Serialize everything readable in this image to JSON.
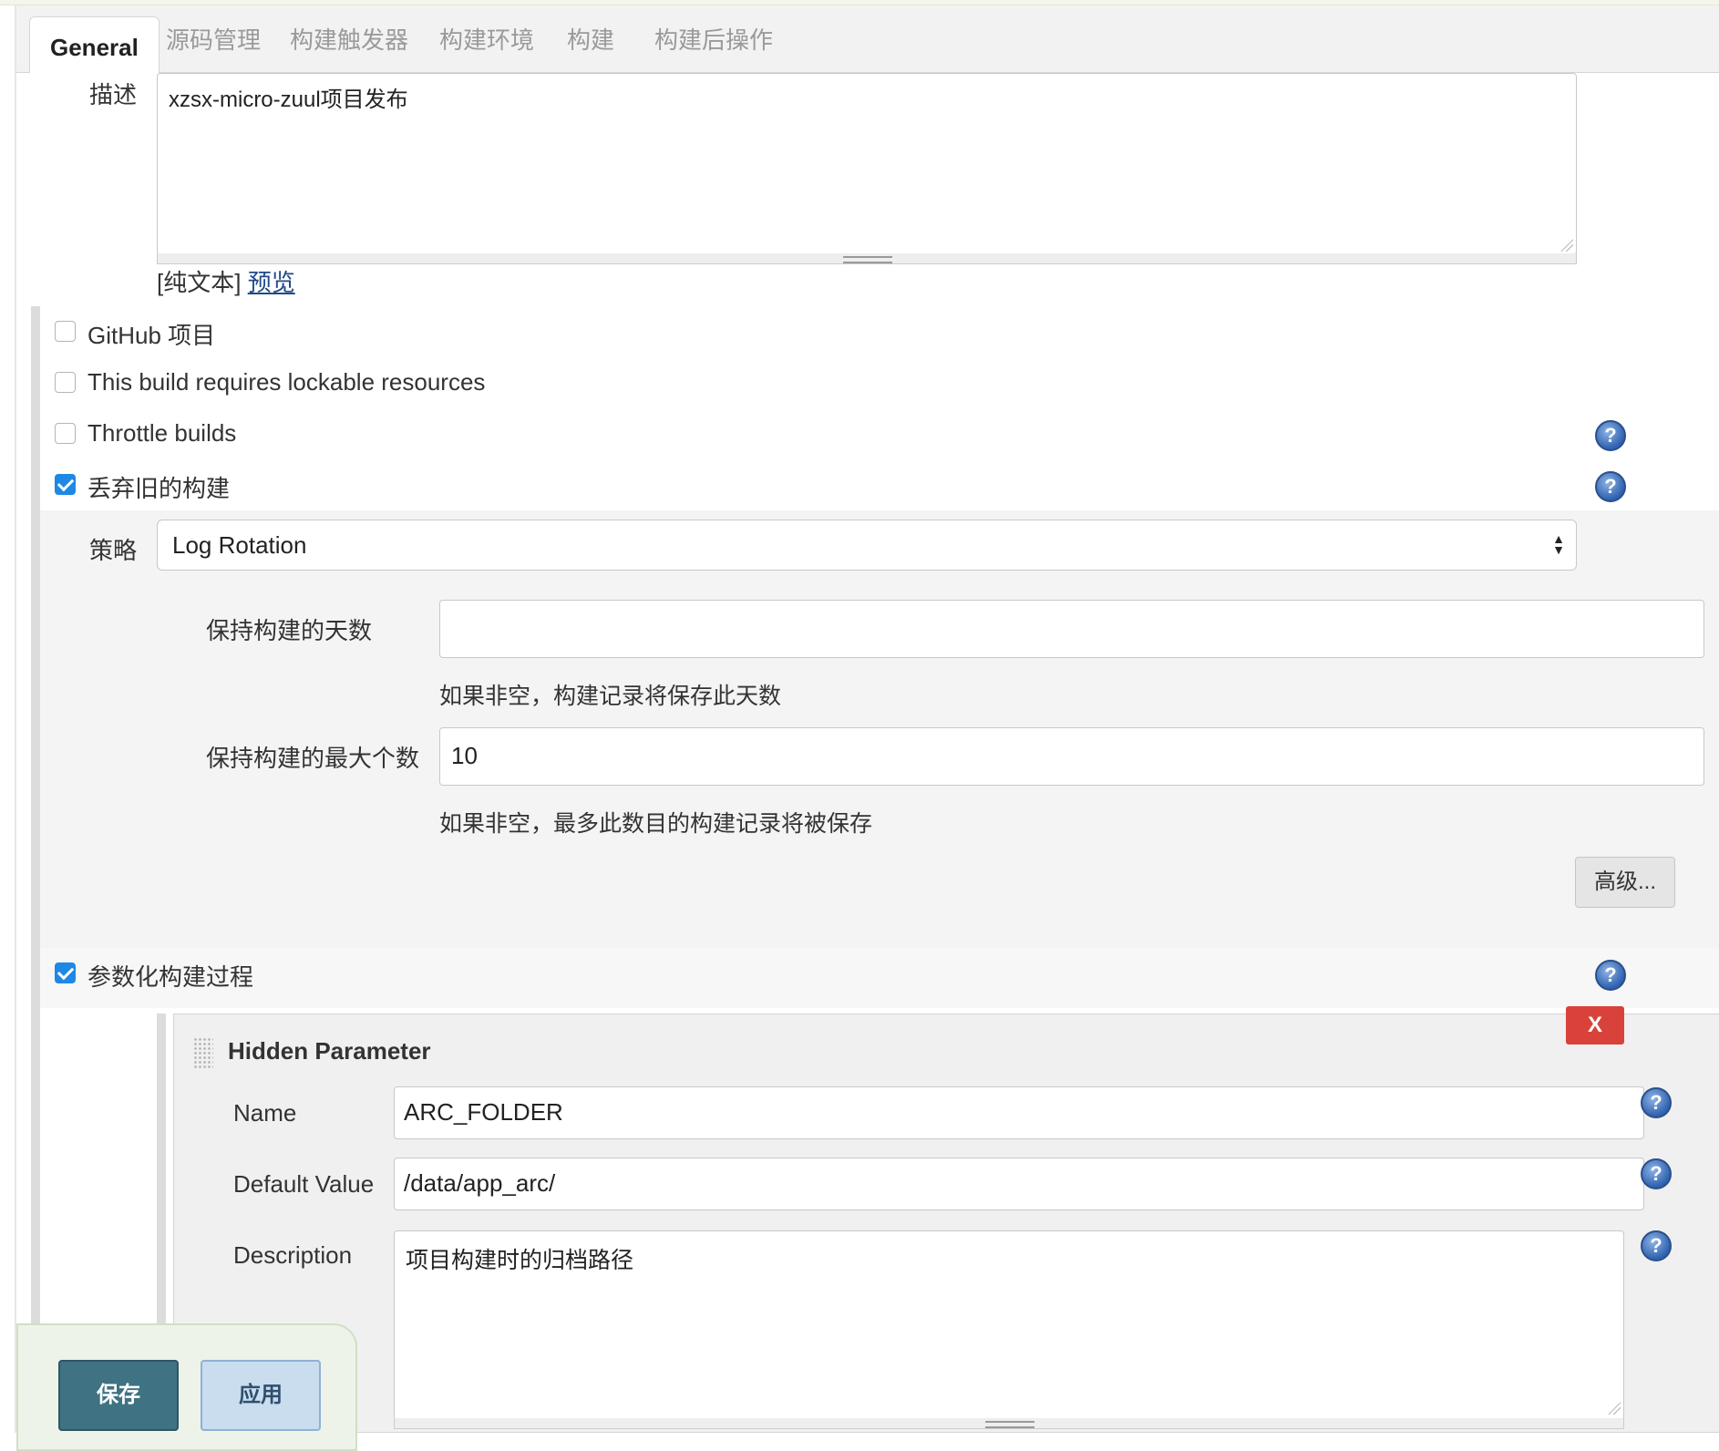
{
  "tabs": [
    {
      "label": "General",
      "active": true
    },
    {
      "label": "源码管理"
    },
    {
      "label": "构建触发器"
    },
    {
      "label": "构建环境"
    },
    {
      "label": "构建"
    },
    {
      "label": "构建后操作"
    }
  ],
  "description": {
    "label": "描述",
    "value": "xzsx-micro-zuul项目发布",
    "markup_prefix": "[纯文本]",
    "preview_link": "预览"
  },
  "options": [
    {
      "label": "GitHub 项目",
      "checked": false
    },
    {
      "label": "This build requires lockable resources",
      "checked": false
    },
    {
      "label": "Throttle builds",
      "checked": false
    },
    {
      "label": "丢弃旧的构建",
      "checked": true
    }
  ],
  "discard": {
    "strategy_label": "策略",
    "strategy_value": "Log Rotation",
    "days_label": "保持构建的天数",
    "days_value": "",
    "days_hint": "如果非空，构建记录将保存此天数",
    "max_label": "保持构建的最大个数",
    "max_value": "10",
    "max_hint": "如果非空，最多此数目的构建记录将被保存",
    "advanced_button": "高级..."
  },
  "parameterized": {
    "label": "参数化构建过程",
    "checked": true
  },
  "hidden_parameter": {
    "title": "Hidden Parameter",
    "delete_label": "X",
    "name_label": "Name",
    "name_value": "ARC_FOLDER",
    "default_label": "Default Value",
    "default_value": "/data/app_arc/",
    "description_label": "Description",
    "description_value": "项目构建时的归档路径"
  },
  "footer": {
    "save": "保存",
    "apply": "应用"
  },
  "help_icon_glyph": "?",
  "colors": {
    "checkbox_checked": "#1e88e5",
    "save_button": "#3f7282",
    "apply_button": "#c9ddef",
    "delete_button": "#d9423a"
  }
}
